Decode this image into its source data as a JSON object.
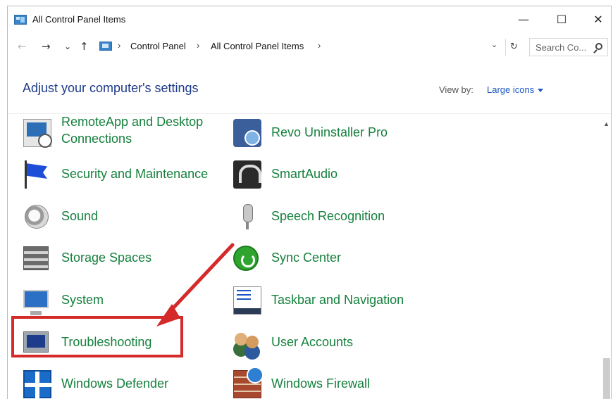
{
  "window": {
    "title": "All Control Panel Items",
    "controls": {
      "minimize": "—",
      "maximize": "☐",
      "close": "✕"
    }
  },
  "nav": {
    "back": "←",
    "forward": "→",
    "recent": "⌄",
    "up": "↑",
    "breadcrumbs": [
      "Control Panel",
      "All Control Panel Items"
    ],
    "separator": "›",
    "dropdown": "⌄",
    "refresh": "↻",
    "search_placeholder": "Search Co..."
  },
  "header": {
    "title": "Adjust your computer's settings",
    "view_by_label": "View by:",
    "view_by_value": "Large icons"
  },
  "items_left": [
    {
      "label_line1": "RemoteApp and Desktop",
      "label_line2": "Connections",
      "icon": "remoteapp-icon"
    },
    {
      "label": "Security and Maintenance",
      "icon": "security-flag-icon"
    },
    {
      "label": "Sound",
      "icon": "speaker-icon"
    },
    {
      "label": "Storage Spaces",
      "icon": "storage-icon"
    },
    {
      "label": "System",
      "icon": "monitor-icon"
    },
    {
      "label": "Troubleshooting",
      "icon": "troubleshooting-icon"
    },
    {
      "label": "Windows Defender",
      "icon": "shield-icon"
    }
  ],
  "items_right": [
    {
      "label": "Revo Uninstaller Pro",
      "icon": "revo-icon"
    },
    {
      "label": "SmartAudio",
      "icon": "headphones-icon"
    },
    {
      "label": "Speech Recognition",
      "icon": "microphone-icon"
    },
    {
      "label": "Sync Center",
      "icon": "sync-icon"
    },
    {
      "label": "Taskbar and Navigation",
      "icon": "taskbar-icon"
    },
    {
      "label": "User Accounts",
      "icon": "users-icon"
    },
    {
      "label": "Windows Firewall",
      "icon": "firewall-icon"
    }
  ],
  "annotation": {
    "highlight_color": "#d42a2a",
    "target": "Troubleshooting"
  },
  "colors": {
    "link_green": "#15803d",
    "heading_blue": "#1e3a8a",
    "accent_blue": "#1a56c4"
  }
}
